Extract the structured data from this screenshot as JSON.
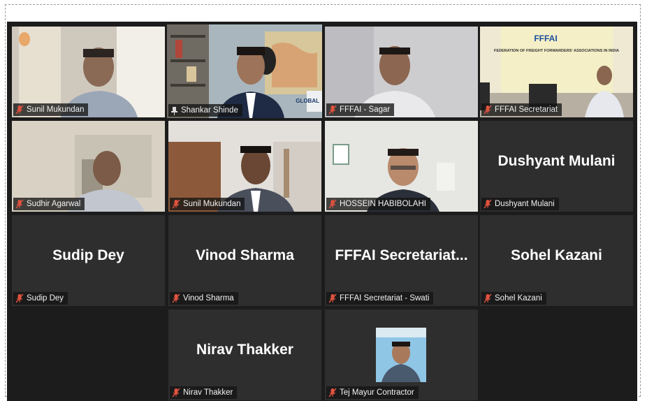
{
  "meeting": {
    "tiles": [
      {
        "id": "t1",
        "name": "Sunil Mukundan",
        "muted": true,
        "pinned": false,
        "video": true
      },
      {
        "id": "t2",
        "name": "Shankar Shinde",
        "muted": false,
        "pinned": true,
        "video": true,
        "active": true
      },
      {
        "id": "t3",
        "name": "FFFAI - Sagar",
        "muted": true,
        "pinned": false,
        "video": true
      },
      {
        "id": "t4",
        "name": "FFFAI Secretariat",
        "muted": true,
        "pinned": false,
        "video": true
      },
      {
        "id": "t5",
        "name": "Sudhir Agarwal",
        "muted": true,
        "pinned": false,
        "video": true
      },
      {
        "id": "t6",
        "name": "Sunil Mukundan",
        "muted": true,
        "pinned": false,
        "video": true
      },
      {
        "id": "t7",
        "name": "HOSSEIN HABIBOLAHI",
        "muted": true,
        "pinned": false,
        "video": true
      },
      {
        "id": "t8",
        "name": "Dushyant Mulani",
        "display": "Dushyant Mulani",
        "muted": true,
        "video": false
      },
      {
        "id": "t9",
        "name": "Sudip Dey",
        "display": "Sudip Dey",
        "muted": true,
        "video": false
      },
      {
        "id": "t10",
        "name": "Vinod Sharma",
        "display": "Vinod Sharma",
        "muted": true,
        "video": false
      },
      {
        "id": "t11",
        "name": "FFFAI Secretariat - Swati",
        "display": "FFFAI  Secretariat...",
        "muted": true,
        "video": false
      },
      {
        "id": "t12",
        "name": "Sohel Kazani",
        "display": "Sohel Kazani",
        "muted": true,
        "video": false
      },
      {
        "id": "t13",
        "name": "Nirav Thakker",
        "display": "Nirav Thakker",
        "muted": true,
        "video": false
      },
      {
        "id": "t14",
        "name": "Tej Mayur Contractor",
        "muted": true,
        "video": false,
        "avatar": true
      }
    ],
    "banner_text": "FEDERATION OF FREIGHT FORWARDERS' ASSOCIATIONS IN INDIA",
    "banner_logo": "FFFAI",
    "logo_text": "GLOBAL"
  },
  "colors": {
    "muted_icon": "#e0523f",
    "active_border": "#d6e86b",
    "tile_bg": "#2e2e2e"
  }
}
